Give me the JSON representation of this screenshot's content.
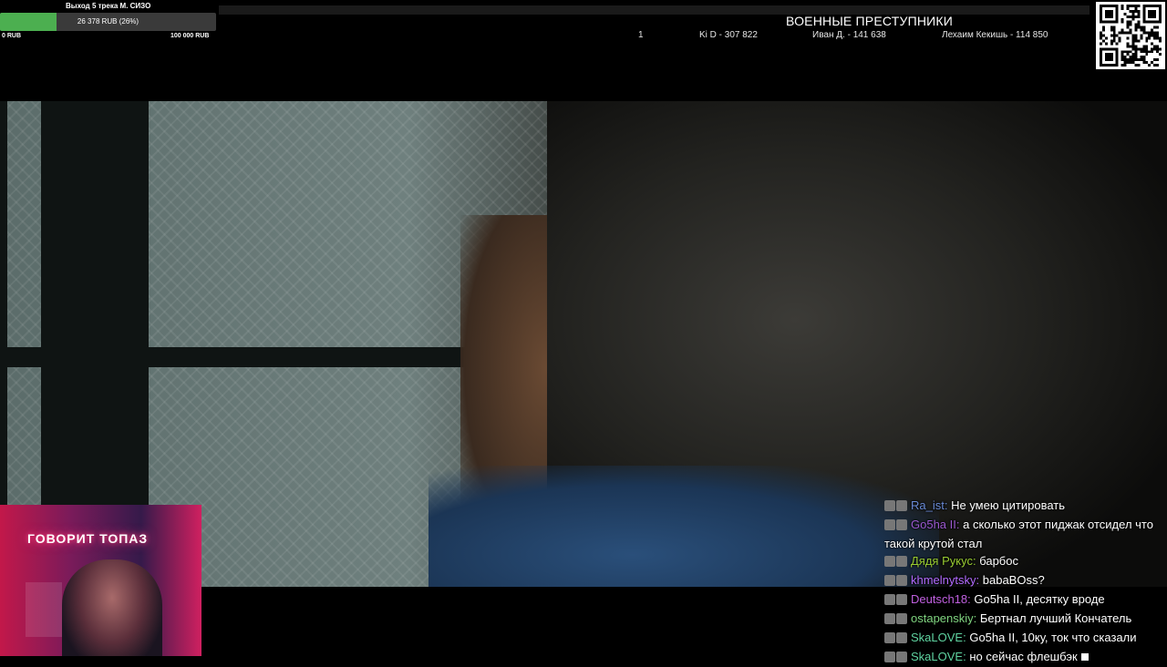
{
  "donation_goal": {
    "title": "Выход 5 трека М. СИЗО",
    "progress_text": "26 378 RUB (26%)",
    "progress_fraction": 0.26,
    "min_label": "0 RUB",
    "max_label": "100 000 RUB",
    "colors": {
      "fill": "#4caf50",
      "track": "#3a3a3a"
    }
  },
  "leaderboard": {
    "title": "ВОЕННЫЕ ПРЕСТУПНИКИ",
    "entries": [
      "1",
      "Ki D - 307 822",
      "Иван Д. - 141 638",
      "Лехаим Кекишь - 114 850"
    ]
  },
  "webcam": {
    "sign": "ГОВОРИТ ТОПАЗ"
  },
  "chat": {
    "messages": [
      {
        "nick": "Ra_ist",
        "text": "Не умею цитировать",
        "color": "#6a8bd6"
      },
      {
        "nick": "Go5ha II",
        "text": "а сколько этот пиджак отсидел что такой крутой стал",
        "color": "#9b59d0"
      },
      {
        "nick": "Дядя Рукус",
        "text": "барбос",
        "color": "#9acd32"
      },
      {
        "nick": "khmelnytsky",
        "text": "babaBOss?",
        "color": "#b36bff"
      },
      {
        "nick": "Deutsch18",
        "text": "Go5ha II, десятку вроде",
        "color": "#c060e0"
      },
      {
        "nick": "ostapenskiy",
        "text": "Бертнал лучший Кончатель",
        "color": "#7fd37f"
      },
      {
        "nick": "SkaLOVE",
        "text": "Go5ha II, 10ку, ток что сказали",
        "color": "#5fd3a0"
      },
      {
        "nick": "SkaLOVE",
        "text": "но сейчас флешбэк",
        "color": "#5fd3a0"
      }
    ]
  },
  "icons": {
    "qr": "qr-code-icon",
    "badge": "user-badge-icon"
  }
}
